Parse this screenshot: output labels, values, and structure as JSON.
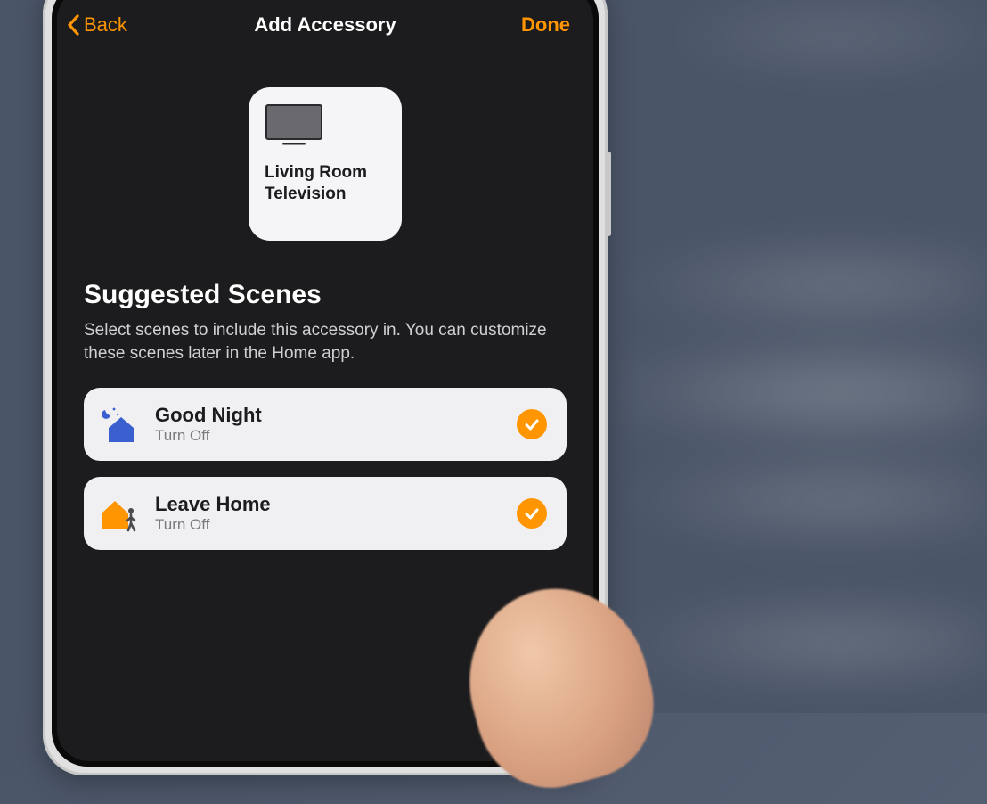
{
  "colors": {
    "accent": "#ff9500",
    "bg_dark": "#1c1c1e",
    "tile_bg": "#f5f5f7",
    "row_bg": "#f0f0f2",
    "text_secondary": "#7a7a7e"
  },
  "nav": {
    "back_label": "Back",
    "title": "Add Accessory",
    "done_label": "Done"
  },
  "accessory": {
    "name": "Living Room Television",
    "icon": "tv-icon"
  },
  "section": {
    "title": "Suggested Scenes",
    "description": "Select scenes to include this accessory in. You can customize these scenes later in the Home app."
  },
  "scenes": [
    {
      "icon": "moon-house-icon",
      "name": "Good Night",
      "subtitle": "Turn Off",
      "selected": true
    },
    {
      "icon": "house-person-icon",
      "name": "Leave Home",
      "subtitle": "Turn Off",
      "selected": true
    }
  ]
}
